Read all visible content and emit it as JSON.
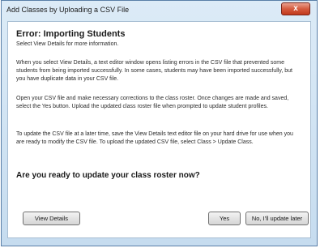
{
  "window": {
    "title": "Add Classes by Uploading a CSV File",
    "close_glyph": "x"
  },
  "content": {
    "heading": "Error: Importing Students",
    "subheading": "Select View Details for more information.",
    "paragraphs": [
      "When you select View Details, a text editor window opens listing errors in the CSV file that prevented some students from being imported successfully. In some cases, students may have been imported successfully, but you have duplicate data in your CSV file.",
      "Open your CSV file and make necessary corrections to the class roster. Once changes are made and saved, select the Yes button. Upload the updated class roster file when prompted to update student profiles.",
      "To update the CSV file at a later time, save the View Details text editor file on your hard drive for use when you are ready to modify the CSV file. To upload the updated CSV file, select Class > Update Class."
    ],
    "question": "Are you ready to update your class roster now?"
  },
  "buttons": {
    "view_details": "View Details",
    "yes": "Yes",
    "later": "No, I'll update later"
  },
  "colors": {
    "accent_close": "#c13a1c",
    "frame": "#c6dcef"
  }
}
